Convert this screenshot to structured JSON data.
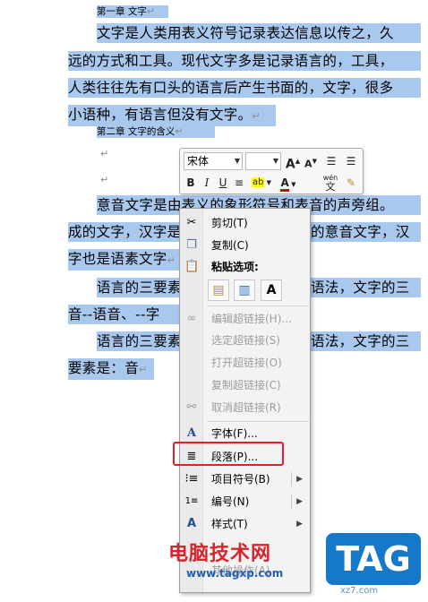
{
  "document": {
    "heading1": "第一章 文字",
    "p1_l1": "文字是人类用表义符号记录表达信息以传之，久",
    "p1_l2": "远的方式和工具。现代文字多是记录语言的，工具，",
    "p1_l3": "人类往往先有口头的语言后产生书面的，文字，很多",
    "p1_l4": "小语种，有语言但没有文字。",
    "heading2": "第二章 文字的含义",
    "p2_l1": "意音文字是由表义的象形符号和表音的声旁组。",
    "p2_l2a": "成的文字，汉字是",
    "p2_l2b": "的意音文字，汉",
    "p2_l3": "字也是语素文字",
    "p3_l1a": "语言的三要素",
    "p3_l1b": "语法，文字的三",
    "p3_l2": "音--语音、--字",
    "p4_l1a": "语言的三要素",
    "p4_l1b": "语法，文字的三",
    "p4_l2": "要素是：音",
    "para_mark": "↵"
  },
  "mini_toolbar": {
    "font_name": "宋体",
    "font_size": "",
    "grow_font": "A",
    "shrink_font": "A",
    "bold": "B",
    "italic": "I",
    "underline": "U",
    "center": "≡",
    "highlight": "ab",
    "font_color": "A",
    "phonetic": "wén",
    "format_painter": "✎"
  },
  "context_menu": {
    "cut": "剪切(T)",
    "copy": "复制(C)",
    "paste_options": "粘贴选项:",
    "paste_keep_format": "▤",
    "paste_merge": "▥",
    "paste_text_only": "A",
    "edit_hyperlink": "编辑超链接(H)...",
    "select_hyperlink": "选定超链接(S)",
    "open_hyperlink": "打开超链接(O)",
    "copy_hyperlink": "复制超链接(C)",
    "remove_hyperlink": "取消超链接(R)",
    "font": "字体(F)...",
    "paragraph": "段落(P)...",
    "bullets": "项目符号(B)",
    "numbering": "编号(N)",
    "styles": "样式(T)",
    "other": "其他操作(A)"
  },
  "watermark": {
    "site_name": "电脑技术网",
    "site_url": "www.tagxp.com",
    "tag": "TAG",
    "tag_sub": "xz7.com"
  },
  "colors": {
    "selection": "#a9c8ee",
    "highlight_box": "#e2202a",
    "tag_blue": "#1578c8",
    "watermark_red": "#d6252c"
  }
}
